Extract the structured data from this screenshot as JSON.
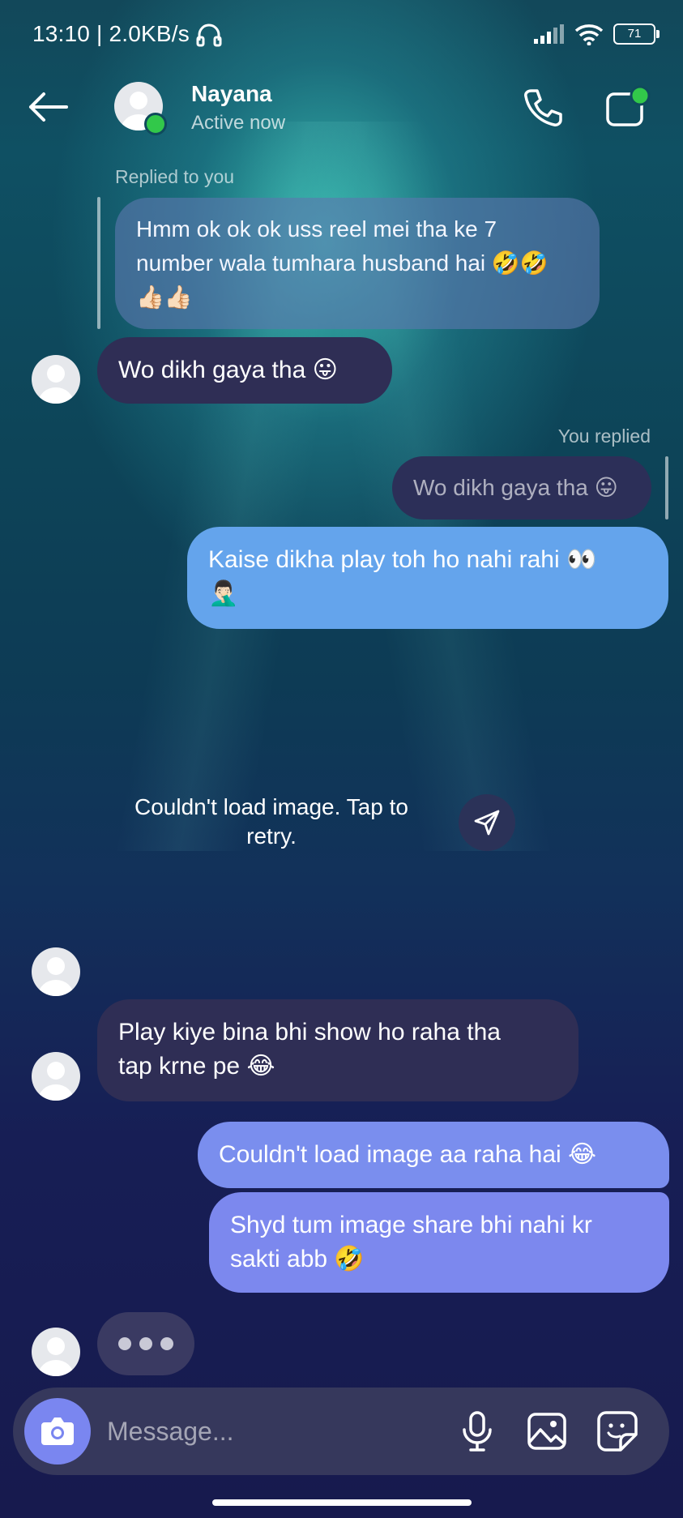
{
  "status_bar": {
    "time_speed": "13:10 | 2.0KB/s",
    "battery": "71"
  },
  "header": {
    "name": "Nayana",
    "status": "Active now"
  },
  "messages": {
    "replied_label_in": "Replied to you",
    "reply_quote_in": "Hmm ok ok ok uss reel mei tha ke 7\nnumber wala tumhara husband hai 🤣🤣\n👍🏻👍🏻",
    "msg1": "Wo dikh gaya tha 😛",
    "replied_label_out": "You replied",
    "reply_quote_out": "Wo dikh gaya tha 😛",
    "msg2": "Kaise dikha play toh ho nahi rahi 👀\n🤦🏻‍♂️",
    "image_error": "Couldn't load image. Tap to\nretry.",
    "msg3": "Play kiye bina bhi show ho raha tha\ntap krne pe 😂",
    "msg4": "Couldn't load image aa raha hai 😂",
    "msg5": "Shyd tum image share bhi nahi kr\nsakti abb 🤣"
  },
  "composer": {
    "placeholder": "Message..."
  },
  "colors": {
    "outgoing_top": "#64a4ec",
    "outgoing_bottom": "#7c88ee",
    "incoming": "#2f2e55",
    "camera_button": "#7a86f0",
    "online": "#32c84a"
  }
}
